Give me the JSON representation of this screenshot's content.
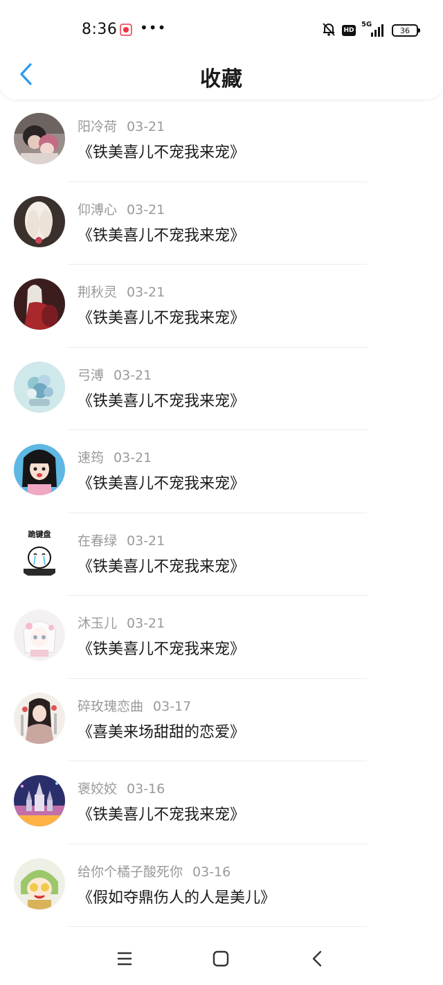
{
  "status_bar": {
    "time": "8:36",
    "more": "•••",
    "hd": "HD",
    "network": "5G",
    "battery": "36"
  },
  "header": {
    "back_icon": "chevron-left-icon",
    "title": "收藏"
  },
  "colors": {
    "accent": "#2a97f0",
    "meta_text": "#999999",
    "title_text": "#1a1a1a"
  },
  "favorites": [
    {
      "author": "阳冷荷",
      "date": "03-21",
      "title": "《铁美喜儿不宠我来宠》"
    },
    {
      "author": "仰溥心",
      "date": "03-21",
      "title": "《铁美喜儿不宠我来宠》"
    },
    {
      "author": "荆秋灵",
      "date": "03-21",
      "title": "《铁美喜儿不宠我来宠》"
    },
    {
      "author": "弓溥",
      "date": "03-21",
      "title": "《铁美喜儿不宠我来宠》"
    },
    {
      "author": "速筠",
      "date": "03-21",
      "title": "《铁美喜儿不宠我来宠》"
    },
    {
      "author": "在春绿",
      "date": "03-21",
      "title": "《铁美喜儿不宠我来宠》",
      "avatar_caption": "跪键盘"
    },
    {
      "author": "沐玉儿",
      "date": "03-21",
      "title": "《铁美喜儿不宠我来宠》"
    },
    {
      "author": "碎玫瑰恋曲",
      "date": "03-17",
      "title": "《喜美来场甜甜的恋爱》"
    },
    {
      "author": "褒姣姣",
      "date": "03-16",
      "title": "《铁美喜儿不宠我来宠》"
    },
    {
      "author": "给你个橘子酸死你",
      "date": "03-16",
      "title": "《假如夺鼎伤人的人是美儿》"
    }
  ],
  "nav_bar": {
    "menu_icon": "menu-icon",
    "home_icon": "home-square-icon",
    "back_icon": "back-triangle-icon"
  }
}
